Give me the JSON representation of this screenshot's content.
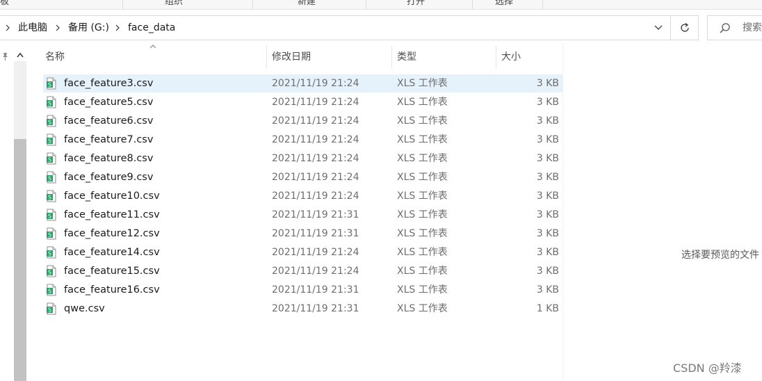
{
  "ribbon": {
    "items": [
      "板",
      "组织",
      "新建",
      "打开",
      "选择"
    ]
  },
  "address": {
    "crumbs": [
      "此电脑",
      "备用 (G:)",
      "face_data"
    ]
  },
  "search": {
    "placeholder": "搜索"
  },
  "columns": {
    "name": "名称",
    "date": "修改日期",
    "type": "类型",
    "size": "大小"
  },
  "files": [
    {
      "name": "face_feature3.csv",
      "date": "2021/11/19 21:24",
      "type": "XLS 工作表",
      "size": "3 KB"
    },
    {
      "name": "face_feature5.csv",
      "date": "2021/11/19 21:24",
      "type": "XLS 工作表",
      "size": "3 KB"
    },
    {
      "name": "face_feature6.csv",
      "date": "2021/11/19 21:24",
      "type": "XLS 工作表",
      "size": "3 KB"
    },
    {
      "name": "face_feature7.csv",
      "date": "2021/11/19 21:24",
      "type": "XLS 工作表",
      "size": "3 KB"
    },
    {
      "name": "face_feature8.csv",
      "date": "2021/11/19 21:24",
      "type": "XLS 工作表",
      "size": "3 KB"
    },
    {
      "name": "face_feature9.csv",
      "date": "2021/11/19 21:24",
      "type": "XLS 工作表",
      "size": "3 KB"
    },
    {
      "name": "face_feature10.csv",
      "date": "2021/11/19 21:24",
      "type": "XLS 工作表",
      "size": "3 KB"
    },
    {
      "name": "face_feature11.csv",
      "date": "2021/11/19 21:31",
      "type": "XLS 工作表",
      "size": "3 KB"
    },
    {
      "name": "face_feature12.csv",
      "date": "2021/11/19 21:31",
      "type": "XLS 工作表",
      "size": "3 KB"
    },
    {
      "name": "face_feature14.csv",
      "date": "2021/11/19 21:24",
      "type": "XLS 工作表",
      "size": "3 KB"
    },
    {
      "name": "face_feature15.csv",
      "date": "2021/11/19 21:24",
      "type": "XLS 工作表",
      "size": "3 KB"
    },
    {
      "name": "face_feature16.csv",
      "date": "2021/11/19 21:31",
      "type": "XLS 工作表",
      "size": "3 KB"
    },
    {
      "name": "qwe.csv",
      "date": "2021/11/19 21:31",
      "type": "XLS 工作表",
      "size": "1 KB"
    }
  ],
  "preview": {
    "message": "选择要预览的文件"
  },
  "watermark": "CSDN @羚漆",
  "icons": {
    "file": "csv-spreadsheet-icon",
    "pin": "pin-icon",
    "refresh": "refresh-icon",
    "search": "search-icon"
  },
  "colors": {
    "selection": "#e5f1fb",
    "file_icon_green": "#21a366"
  }
}
